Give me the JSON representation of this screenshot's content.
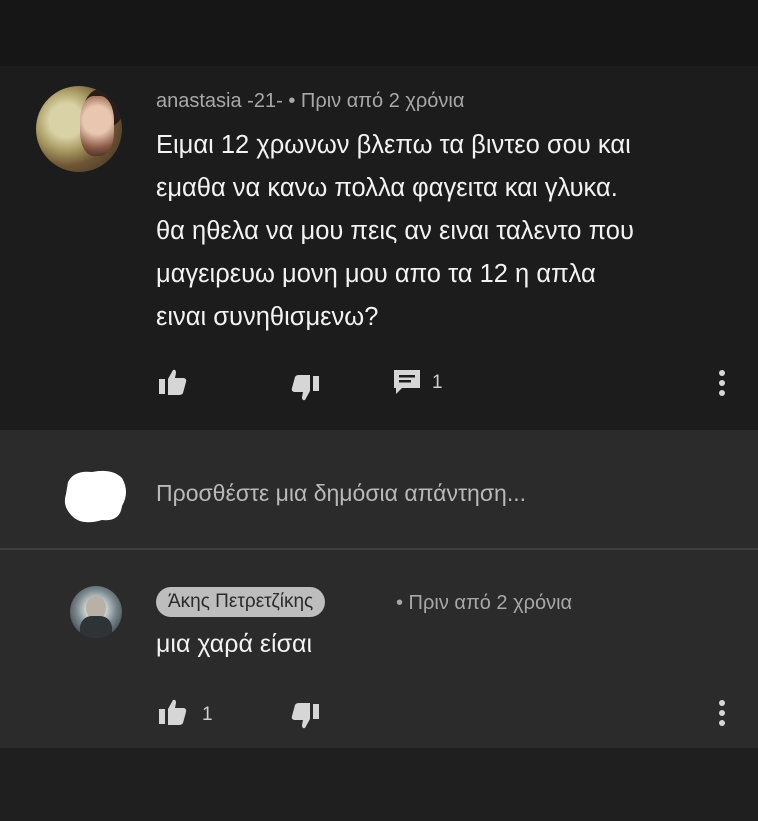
{
  "comment": {
    "author": "anastasia -21-",
    "time": "• Πριν από 2 χρόνια",
    "text_lines": [
      "Ειμαι 12 χρωνων βλεπω τα βιντεο σου και",
      "εμαθα να κανω πολλα φαγειτα και γλυκα.",
      "θα ηθελα να μου πεις αν ειναι ταλεντο που",
      "μαγειρευω μονη μου απο τα 12  η απλα",
      "ειναι συνηθισμενω?"
    ],
    "reply_count": "1"
  },
  "reply_box": {
    "placeholder": "Προσθέστε μια δημόσια απάντηση..."
  },
  "reply": {
    "author": "Άκης Πετρετζίκης",
    "time": "• Πριν από 2 χρόνια",
    "text": "μια χαρά είσαι",
    "like_count": "1"
  },
  "icons": {
    "like": "thumbs-up-icon",
    "dislike": "thumbs-down-icon",
    "reply": "comment-icon",
    "more": "more-vert-icon"
  },
  "colors": {
    "background": "#1c1c1c",
    "reply_background": "#2b2b2b",
    "text": "#f2f2f2",
    "meta": "#a8a8a8",
    "author_chip": "#bdbdbd"
  }
}
